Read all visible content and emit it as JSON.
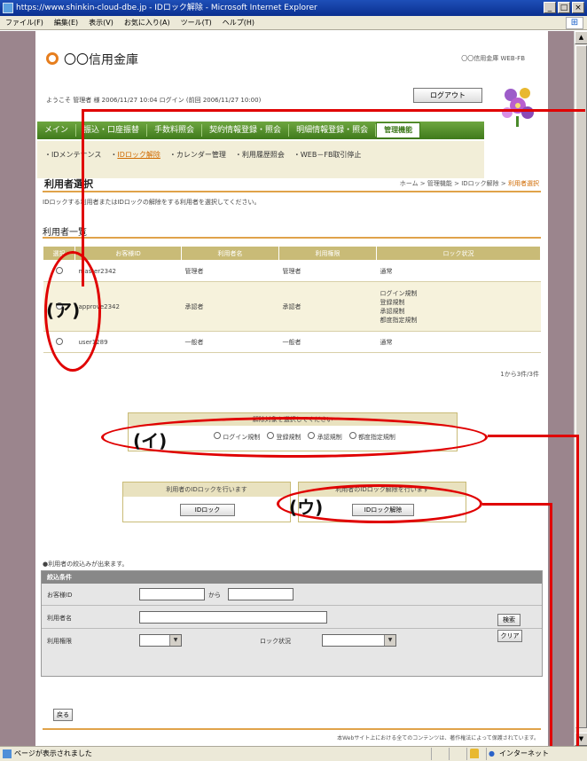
{
  "window": {
    "title": "https://www.shinkin-cloud-dbe.jp - IDロック解除 - Microsoft Internet Explorer",
    "menu": [
      "ファイル(F)",
      "編集(E)",
      "表示(V)",
      "お気に入り(A)",
      "ツール(T)",
      "ヘルプ(H)"
    ],
    "status": "ページが表示されました",
    "zone": "インターネット"
  },
  "header": {
    "bank_name": "〇〇信用金庫",
    "bank_code": "〇〇信用金庫 WEB-FB",
    "welcome": "ようこそ 管理者 様 2006/11/27 10:04 ログイン (前回 2006/11/27 10:00)",
    "logout": "ログアウト"
  },
  "nav": {
    "tabs": [
      "メイン",
      "振込・口座振替",
      "手数料照会",
      "契約情報登録・照会",
      "明細情報登録・照会",
      "管理機能"
    ]
  },
  "subnav": {
    "items": [
      "IDメンテナンス",
      "IDロック解除",
      "カレンダー管理",
      "利用履歴照会",
      "WEB－FB取引停止"
    ]
  },
  "page": {
    "title": "利用者選択",
    "breadcrumb_prefix": "ホーム > 管理機能 > IDロック解除 > ",
    "breadcrumb_current": "利用者選択",
    "instruction": "IDロックする利用者またはIDロックの解除をする利用者を選択してください。",
    "list_title": "利用者一覧",
    "count": "1から3件/3件"
  },
  "table": {
    "headers": [
      "選択",
      "お客様ID",
      "利用者名",
      "利用権限",
      "ロック状況"
    ],
    "rows": [
      {
        "id": "master2342",
        "name": "管理者",
        "role": "管理者",
        "lock": [
          "通常"
        ]
      },
      {
        "id": "approve2342",
        "name": "承認者",
        "role": "承認者",
        "lock": [
          "ログイン規制",
          "登録規制",
          "承認規制",
          "都度指定規制"
        ]
      },
      {
        "id": "user1289",
        "name": "一般者",
        "role": "一般者",
        "lock": [
          "通常"
        ]
      }
    ]
  },
  "lock_type": {
    "header": "解除対象を選択してください",
    "options": [
      "ログイン規制",
      "登録規制",
      "承認規制",
      "都度指定規制"
    ]
  },
  "lock_box": {
    "header": "利用者のIDロックを行います",
    "button": "IDロック"
  },
  "unlock_box": {
    "header": "利用者のIDロック解除を行います",
    "button": "IDロック解除"
  },
  "search": {
    "note": "●利用者の絞込みが出来ます。",
    "header": "絞込条件",
    "customer_id_label": "お客様ID",
    "range_sep": "から",
    "user_name_label": "利用者名",
    "role_label": "利用権限",
    "lock_label": "ロック状況",
    "search_button": "検索",
    "clear_button": "クリア"
  },
  "back_button": "戻る",
  "footer": "本Webサイト上における全てのコンテンツは、著作権法によって保護されています。",
  "annotations": [
    "(ア)",
    "(イ)",
    "(ウ)"
  ],
  "colors": {
    "nav_green": "#4e8a28",
    "accent_orange": "#e0a34a",
    "table_header": "#c9bb77",
    "annotation_red": "#e00000"
  }
}
